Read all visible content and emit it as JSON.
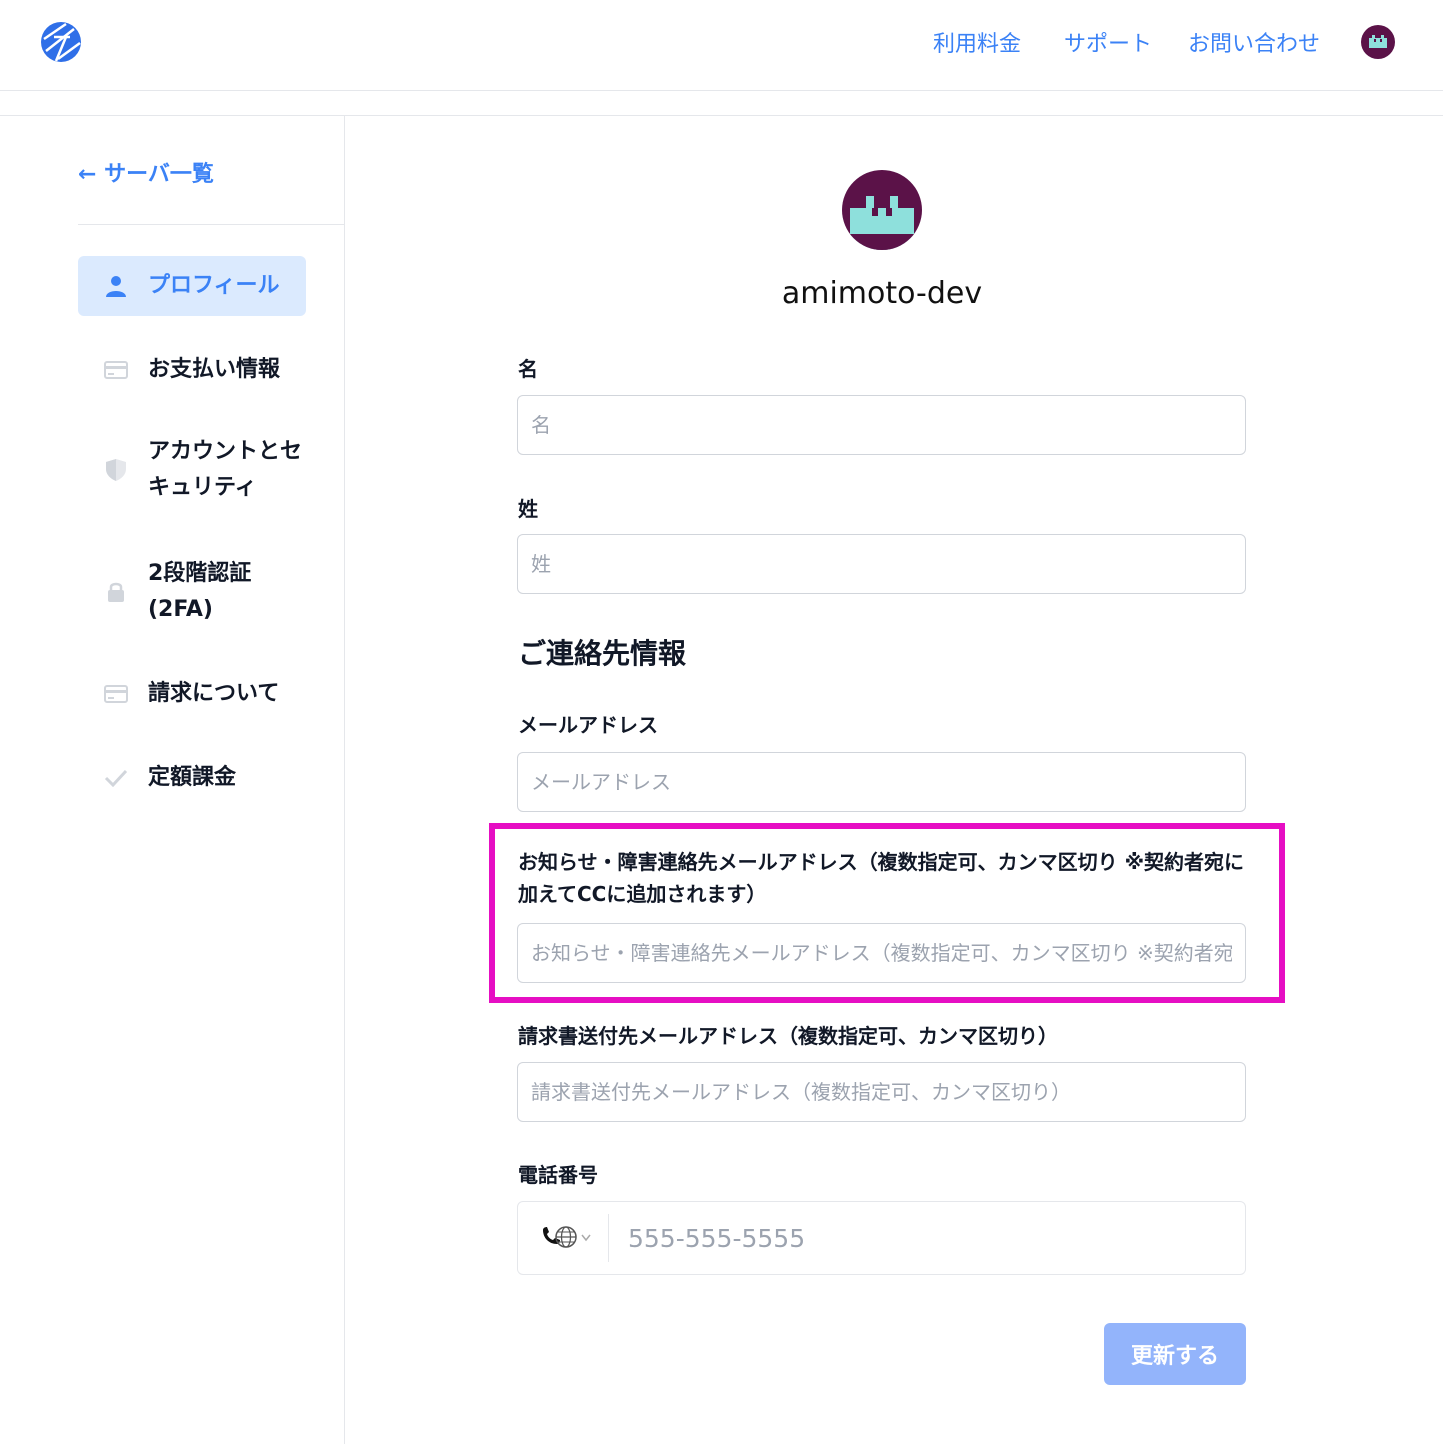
{
  "header": {
    "logo": "logo-icon",
    "nav": {
      "pricing": "利用料金",
      "support": "サポート",
      "contact": "お問い合わせ"
    },
    "avatar": "user-avatar"
  },
  "sidebar": {
    "back": "← サーバ一覧",
    "items": [
      {
        "label": "プロフィール",
        "icon": "user-icon",
        "active": true
      },
      {
        "label": "お支払い情報",
        "icon": "credit-card-icon"
      },
      {
        "label": "アカウントとセキュリティ",
        "icon": "shield-icon"
      },
      {
        "label": "2段階認証(2FA)",
        "icon": "lock-icon"
      },
      {
        "label": "請求について",
        "icon": "credit-card-icon"
      },
      {
        "label": "定額課金",
        "icon": "check-icon"
      }
    ]
  },
  "profile": {
    "username": "amimoto-dev"
  },
  "form": {
    "first_name": {
      "label": "名",
      "placeholder": "名"
    },
    "last_name": {
      "label": "姓",
      "placeholder": "姓"
    },
    "contact_section": "ご連絡先情報",
    "email": {
      "label": "メールアドレス",
      "placeholder": "メールアドレス"
    },
    "notify_email": {
      "label": "お知らせ・障害連絡先メールアドレス（複数指定可、カンマ区切り ※契約者宛に加えてCCに追加されます）",
      "placeholder": "お知らせ・障害連絡先メールアドレス（複数指定可、カンマ区切り ※契約者宛に加えてCCに追加されます）"
    },
    "invoice_email": {
      "label": "請求書送付先メールアドレス（複数指定可、カンマ区切り）",
      "placeholder": "請求書送付先メールアドレス（複数指定可、カンマ区切り）"
    },
    "phone": {
      "label": "電話番号",
      "placeholder": "555-555-5555",
      "country_icon": "globe-phone-icon"
    },
    "submit": "更新する"
  },
  "colors": {
    "accent": "#3b82f6",
    "active_bg": "#dbeafe",
    "highlight": "#e60ec3",
    "submit_bg": "#93b4fb"
  }
}
